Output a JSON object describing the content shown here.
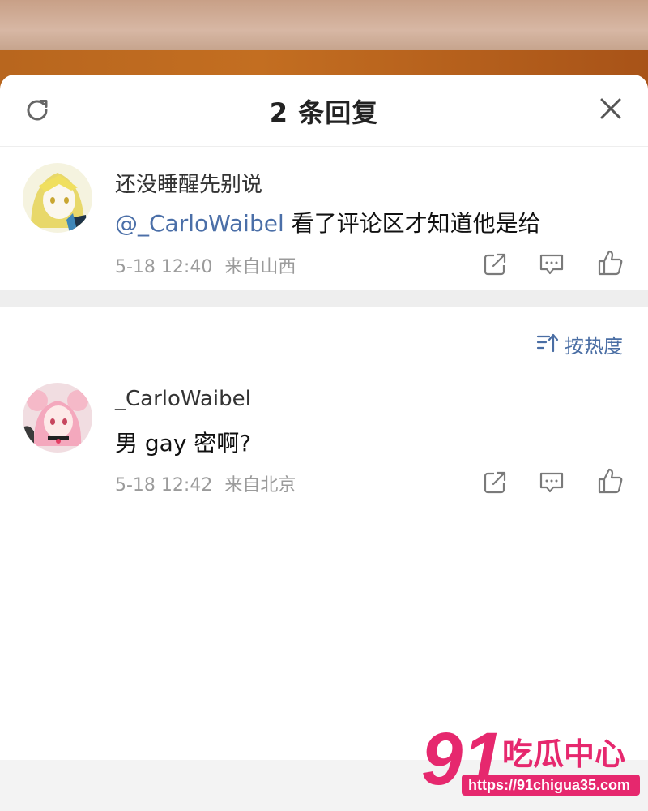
{
  "header": {
    "title": "2 条回复"
  },
  "original_comment": {
    "username": "还没睡醒先别说",
    "mention": "@_CarloWaibel",
    "text": " 看了评论区才知道他是给",
    "time": "5-18 12:40",
    "location": "来自山西"
  },
  "sort": {
    "label": "按热度"
  },
  "replies": [
    {
      "username": "_CarloWaibel",
      "text": "男 gay 密啊?",
      "time": "5-18 12:42",
      "location": "来自北京"
    }
  ],
  "watermark": {
    "number": "91",
    "brand": "吃瓜中心",
    "url": "https://91chigua35.com"
  },
  "colors": {
    "accent": "#4a6ea4",
    "brand_pink": "#e6286e"
  },
  "icons": {
    "refresh": "refresh-icon",
    "close": "close-icon",
    "share": "share-icon",
    "comment": "comment-icon",
    "like": "like-icon",
    "sort": "sort-icon"
  }
}
